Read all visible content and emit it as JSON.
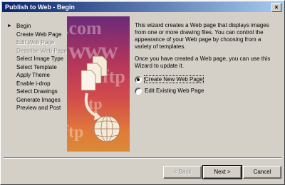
{
  "window": {
    "title": "Publish to Web - Begin",
    "close_glyph": "×"
  },
  "steps": [
    {
      "label": "Begin",
      "state": "current"
    },
    {
      "label": "Create Web Page",
      "state": "enabled"
    },
    {
      "label": "Edit Web Page",
      "state": "disabled"
    },
    {
      "label": "Describe Web Page",
      "state": "disabled"
    },
    {
      "label": "Select Image Type",
      "state": "enabled"
    },
    {
      "label": "Select Template",
      "state": "enabled"
    },
    {
      "label": "Apply Theme",
      "state": "enabled"
    },
    {
      "label": "Enable i-drop",
      "state": "enabled"
    },
    {
      "label": "Select Drawings",
      "state": "enabled"
    },
    {
      "label": "Generate Images",
      "state": "enabled"
    },
    {
      "label": "Preview and Post",
      "state": "enabled"
    }
  ],
  "current_step_marker": "►",
  "art": {
    "watermark": [
      ".com",
      "www",
      "ftp",
      "tp",
      "ftp"
    ]
  },
  "content": {
    "intro": "This wizard creates a Web page that displays images from one or more drawing files.  You can control the appearance of your Web page by choosing from a variety of templates.",
    "update_note": "Once you have created a Web page, you can use this Wizard to update it.",
    "options": [
      {
        "label": "Create New Web Page",
        "selected": true
      },
      {
        "label": "Edit Existing Web Page",
        "selected": false
      }
    ]
  },
  "buttons": {
    "back": "< Back",
    "next": "Next >",
    "cancel": "Cancel"
  }
}
